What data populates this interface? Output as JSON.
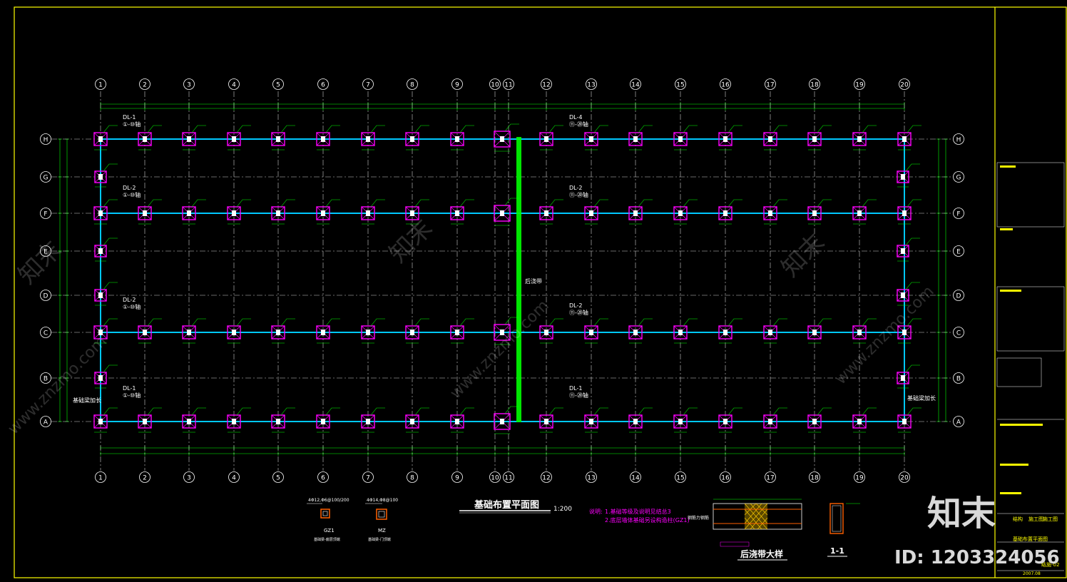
{
  "drawing": {
    "title": "基础布置平面图",
    "scale": "1:200",
    "post_pour_strip": "后浇带",
    "notes_label": "说明:",
    "notes": [
      "1.基础等级及说明见结总3",
      "2.底层墙体基础另设构造柱(GZ1)"
    ],
    "detail_title": "后浇带大样",
    "detail_sub": "钢筋力钢筋",
    "section_title": "1-1",
    "column_labels": [
      {
        "name": "GZ1",
        "rebar": "4Φ12,Φ6@100/200",
        "note": "基础梁-底层顶端"
      },
      {
        "name": "MZ",
        "rebar": "4Φ14,Φ8@100",
        "note": "基础梁-门顶端"
      }
    ]
  },
  "axes": {
    "columns": [
      "1",
      "2",
      "3",
      "4",
      "5",
      "6",
      "7",
      "8",
      "9",
      "10",
      "11",
      "12",
      "13",
      "14",
      "15",
      "16",
      "17",
      "18",
      "19",
      "20"
    ],
    "rows": [
      "H",
      "G",
      "F",
      "E",
      "D",
      "C",
      "B",
      "A"
    ]
  },
  "beam_labels": [
    {
      "text": "DL-1",
      "sub": "①-⑩轴"
    },
    {
      "text": "DL-2",
      "sub": "①-⑩轴"
    },
    {
      "text": "DL-2",
      "sub": "①-⑩轴"
    },
    {
      "text": "DL-1",
      "sub": "①-⑩轴"
    },
    {
      "text": "DL-4",
      "sub": "⑪-⑳轴"
    },
    {
      "text": "DL-2",
      "sub": "⑪-⑳轴"
    },
    {
      "text": "DL-2",
      "sub": "⑪-⑳轴"
    },
    {
      "text": "DL-1",
      "sub": "⑪-⑳轴"
    }
  ],
  "side_notes": [
    "基础梁加长",
    "基础梁加长"
  ],
  "title_block": {
    "discipline": "结构",
    "stage": "施工图",
    "drawing_name": "基础布置平面图",
    "drawing_no": "结施-02",
    "date": "2007.08"
  },
  "watermark": {
    "brand": "知末",
    "id_text": "ID: 1203324056",
    "site": "www.znzmo.com"
  },
  "colors": {
    "frame": "#ffff00",
    "grid": "#00ff00",
    "beam": "#00c8ff",
    "footing": "#ff00ff",
    "strip": "#00ff00",
    "text_magenta": "#ff00ff"
  }
}
